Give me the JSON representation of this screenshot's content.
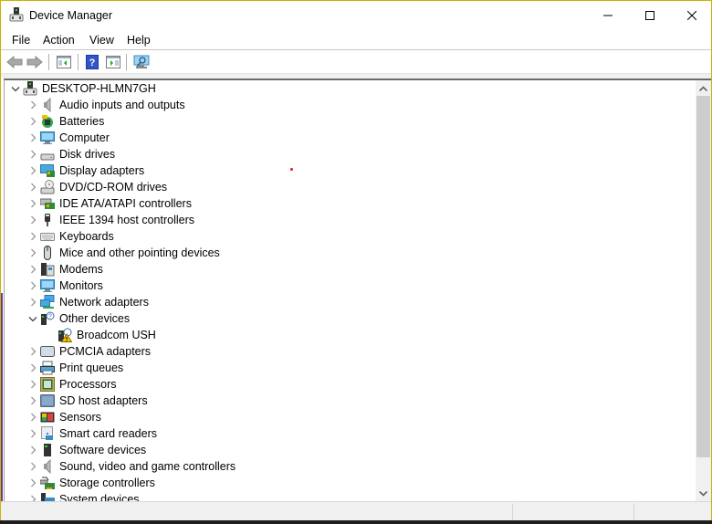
{
  "window": {
    "title": "Device Manager",
    "controls": {
      "minimize": "minimize",
      "maximize": "maximize",
      "close": "close"
    }
  },
  "menu": {
    "items": [
      {
        "label": "File"
      },
      {
        "label": "Action"
      },
      {
        "label": "View"
      },
      {
        "label": "Help"
      }
    ]
  },
  "toolbar": {
    "buttons": [
      {
        "icon": "back-arrow-icon",
        "tooltip": "Back"
      },
      {
        "icon": "forward-arrow-icon",
        "tooltip": "Forward"
      },
      {
        "icon": "show-hide-console-tree-icon",
        "tooltip": "Show/Hide Console Tree"
      },
      {
        "icon": "help-icon",
        "tooltip": "Help"
      },
      {
        "icon": "show-hide-action-pane-icon",
        "tooltip": "Show/Hide Action Pane"
      },
      {
        "icon": "scan-hardware-changes-icon",
        "tooltip": "Scan for hardware changes"
      }
    ]
  },
  "tree": {
    "root": {
      "label": "DESKTOP-HLMN7GH",
      "expanded": true,
      "icon": "computer-root-icon"
    },
    "categories": [
      {
        "label": "Audio inputs and outputs",
        "icon": "speaker-icon",
        "expanded": false
      },
      {
        "label": "Batteries",
        "icon": "battery-icon",
        "expanded": false
      },
      {
        "label": "Computer",
        "icon": "monitor-icon",
        "expanded": false
      },
      {
        "label": "Disk drives",
        "icon": "disk-drive-icon",
        "expanded": false
      },
      {
        "label": "Display adapters",
        "icon": "display-adapter-icon",
        "expanded": false
      },
      {
        "label": "DVD/CD-ROM drives",
        "icon": "dvd-drive-icon",
        "expanded": false
      },
      {
        "label": "IDE ATA/ATAPI controllers",
        "icon": "ide-controller-icon",
        "expanded": false
      },
      {
        "label": "IEEE 1394 host controllers",
        "icon": "ieee1394-icon",
        "expanded": false
      },
      {
        "label": "Keyboards",
        "icon": "keyboard-icon",
        "expanded": false
      },
      {
        "label": "Mice and other pointing devices",
        "icon": "mouse-icon",
        "expanded": false
      },
      {
        "label": "Modems",
        "icon": "modem-icon",
        "expanded": false
      },
      {
        "label": "Monitors",
        "icon": "monitor-icon",
        "expanded": false
      },
      {
        "label": "Network adapters",
        "icon": "network-adapter-icon",
        "expanded": false
      },
      {
        "label": "Other devices",
        "icon": "unknown-device-icon",
        "expanded": true,
        "children": [
          {
            "label": "Broadcom USH",
            "icon": "warning-device-icon",
            "status": "warning"
          }
        ]
      },
      {
        "label": "PCMCIA adapters",
        "icon": "pcmcia-icon",
        "expanded": false
      },
      {
        "label": "Print queues",
        "icon": "printer-icon",
        "expanded": false
      },
      {
        "label": "Processors",
        "icon": "processor-icon",
        "expanded": false
      },
      {
        "label": "SD host adapters",
        "icon": "sd-adapter-icon",
        "expanded": false
      },
      {
        "label": "Sensors",
        "icon": "sensor-icon",
        "expanded": false
      },
      {
        "label": "Smart card readers",
        "icon": "smart-card-reader-icon",
        "expanded": false
      },
      {
        "label": "Software devices",
        "icon": "software-device-icon",
        "expanded": false
      },
      {
        "label": "Sound, video and game controllers",
        "icon": "speaker-icon",
        "expanded": false
      },
      {
        "label": "Storage controllers",
        "icon": "storage-controller-icon",
        "expanded": false
      },
      {
        "label": "System devices",
        "icon": "system-device-icon",
        "expanded": false
      }
    ]
  },
  "colors": {
    "window_border": "#c8b400",
    "selection_dot": "#e81123",
    "warning": "#f5c400"
  },
  "statusbar": {
    "cells": [
      "",
      "",
      ""
    ]
  }
}
